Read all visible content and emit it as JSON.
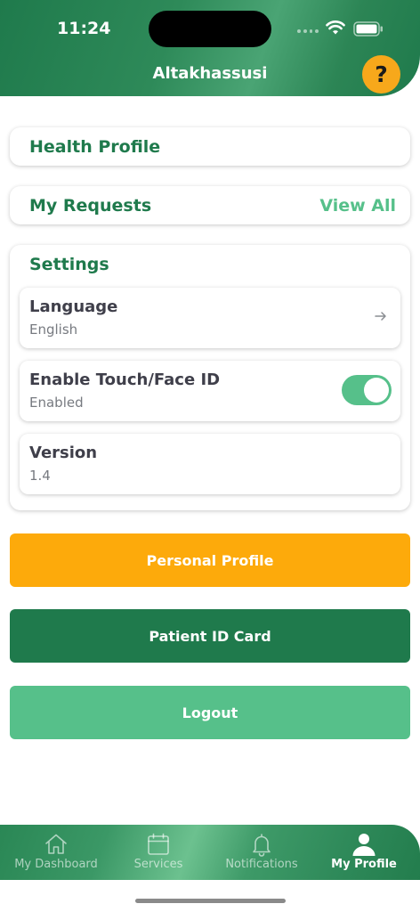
{
  "status_bar": {
    "time": "11:24"
  },
  "header": {
    "title": "Altakhassusi",
    "help_label": "?"
  },
  "health_profile": {
    "title": "Health Profile"
  },
  "my_requests": {
    "title": "My Requests",
    "action": "View All"
  },
  "settings": {
    "title": "Settings",
    "items": [
      {
        "title": "Language",
        "value": "English"
      },
      {
        "title": "Enable Touch/Face ID",
        "value": "Enabled",
        "toggle_on": true
      },
      {
        "title": "Version",
        "value": "1.4"
      }
    ]
  },
  "buttons": {
    "personal_profile": "Personal Profile",
    "patient_id_card": "Patient ID Card",
    "logout": "Logout"
  },
  "colors": {
    "brand_green": "#1f7a4c",
    "accent_light_green": "#56c08a",
    "accent_orange": "#fdaa0b"
  },
  "tabbar": {
    "tabs": [
      {
        "label": "My Dashboard",
        "icon": "home-icon",
        "active": false
      },
      {
        "label": "Services",
        "icon": "calendar-icon",
        "active": false
      },
      {
        "label": "Notifications",
        "icon": "bell-icon",
        "active": false
      },
      {
        "label": "My Profile",
        "icon": "person-icon",
        "active": true
      }
    ]
  }
}
